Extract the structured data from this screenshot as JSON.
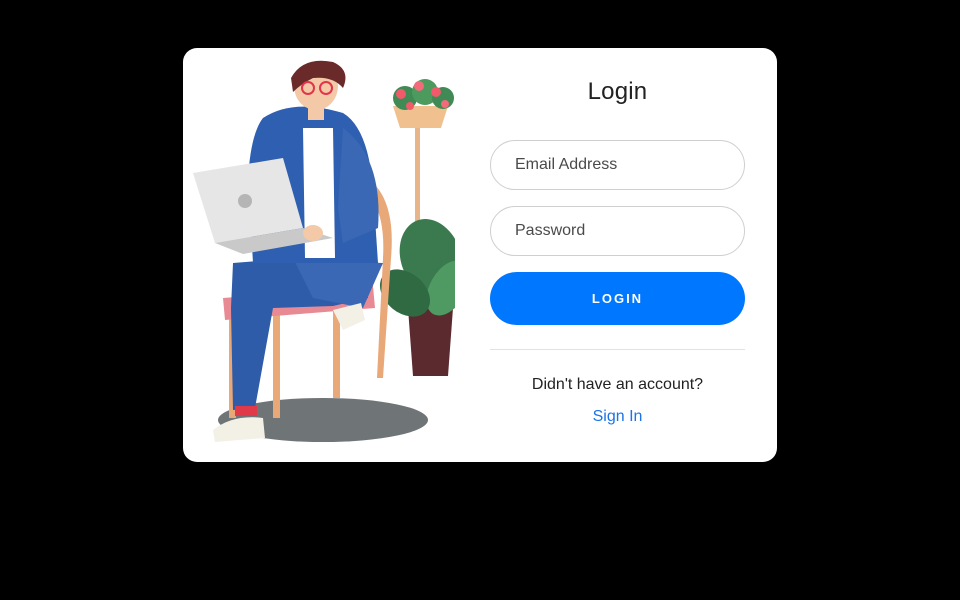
{
  "colors": {
    "background": "#000000",
    "card": "#ffffff",
    "accent": "#0077ff",
    "link": "#1a73e8"
  },
  "illustration": {
    "icon": "person-with-laptop-illustration"
  },
  "login_form": {
    "title": "Login",
    "email_placeholder": "Email Address",
    "password_placeholder": "Password",
    "login_label": "LOGIN",
    "no_account_text": "Didn't have an account?",
    "signin_label": "Sign In"
  }
}
